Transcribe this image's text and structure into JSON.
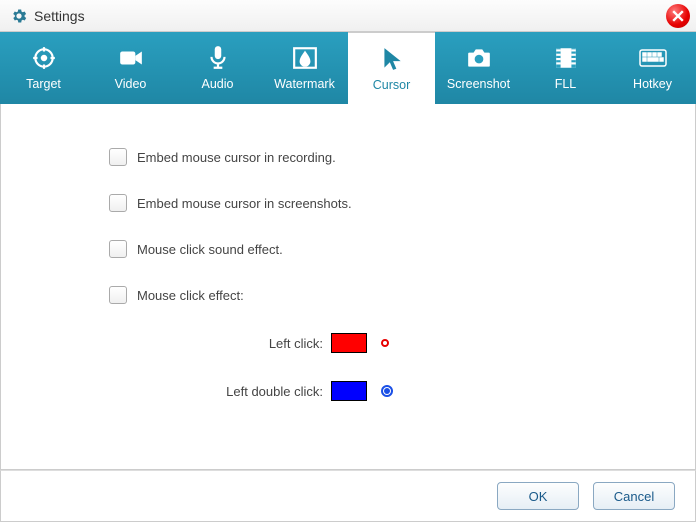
{
  "window": {
    "title": "Settings"
  },
  "tabs": {
    "target": "Target",
    "video": "Video",
    "audio": "Audio",
    "watermark": "Watermark",
    "cursor": "Cursor",
    "screenshot": "Screenshot",
    "fll": "FLL",
    "hotkey": "Hotkey"
  },
  "cursor_options": {
    "embed_recording": "Embed mouse cursor in recording.",
    "embed_screenshots": "Embed mouse cursor in screenshots.",
    "click_sound": "Mouse click sound effect.",
    "click_effect": "Mouse click effect:"
  },
  "click_effect": {
    "left_click_label": "Left click:",
    "left_click_color": "#ff0000",
    "left_dbl_label": "Left double click:",
    "left_dbl_color": "#0000ff"
  },
  "buttons": {
    "ok": "OK",
    "cancel": "Cancel"
  }
}
